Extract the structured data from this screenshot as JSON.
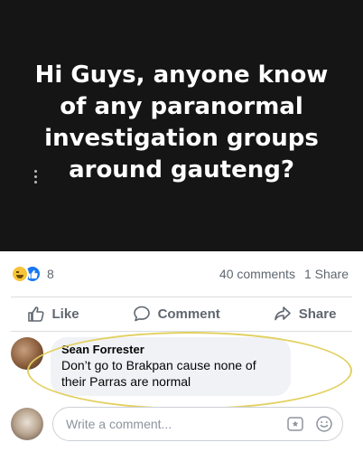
{
  "post": {
    "text": "Hi Guys, anyone know of any paranormal investigation groups around gauteng?"
  },
  "reactions": {
    "count": "8",
    "icons": [
      "haha-icon",
      "like-icon"
    ]
  },
  "stats": {
    "comments": "40 comments",
    "shares": "1 Share"
  },
  "actions": {
    "like_label": "Like",
    "comment_label": "Comment",
    "share_label": "Share"
  },
  "comment": {
    "author": "Sean Forrester",
    "text": "Don’t go to Brakpan cause none of their Parras are normal"
  },
  "compose": {
    "placeholder": "Write a comment..."
  },
  "colors": {
    "banner_bg": "#151515",
    "like_blue": "#1877f2",
    "haha_yellow": "#f7c338",
    "highlight": "#e2d060"
  }
}
